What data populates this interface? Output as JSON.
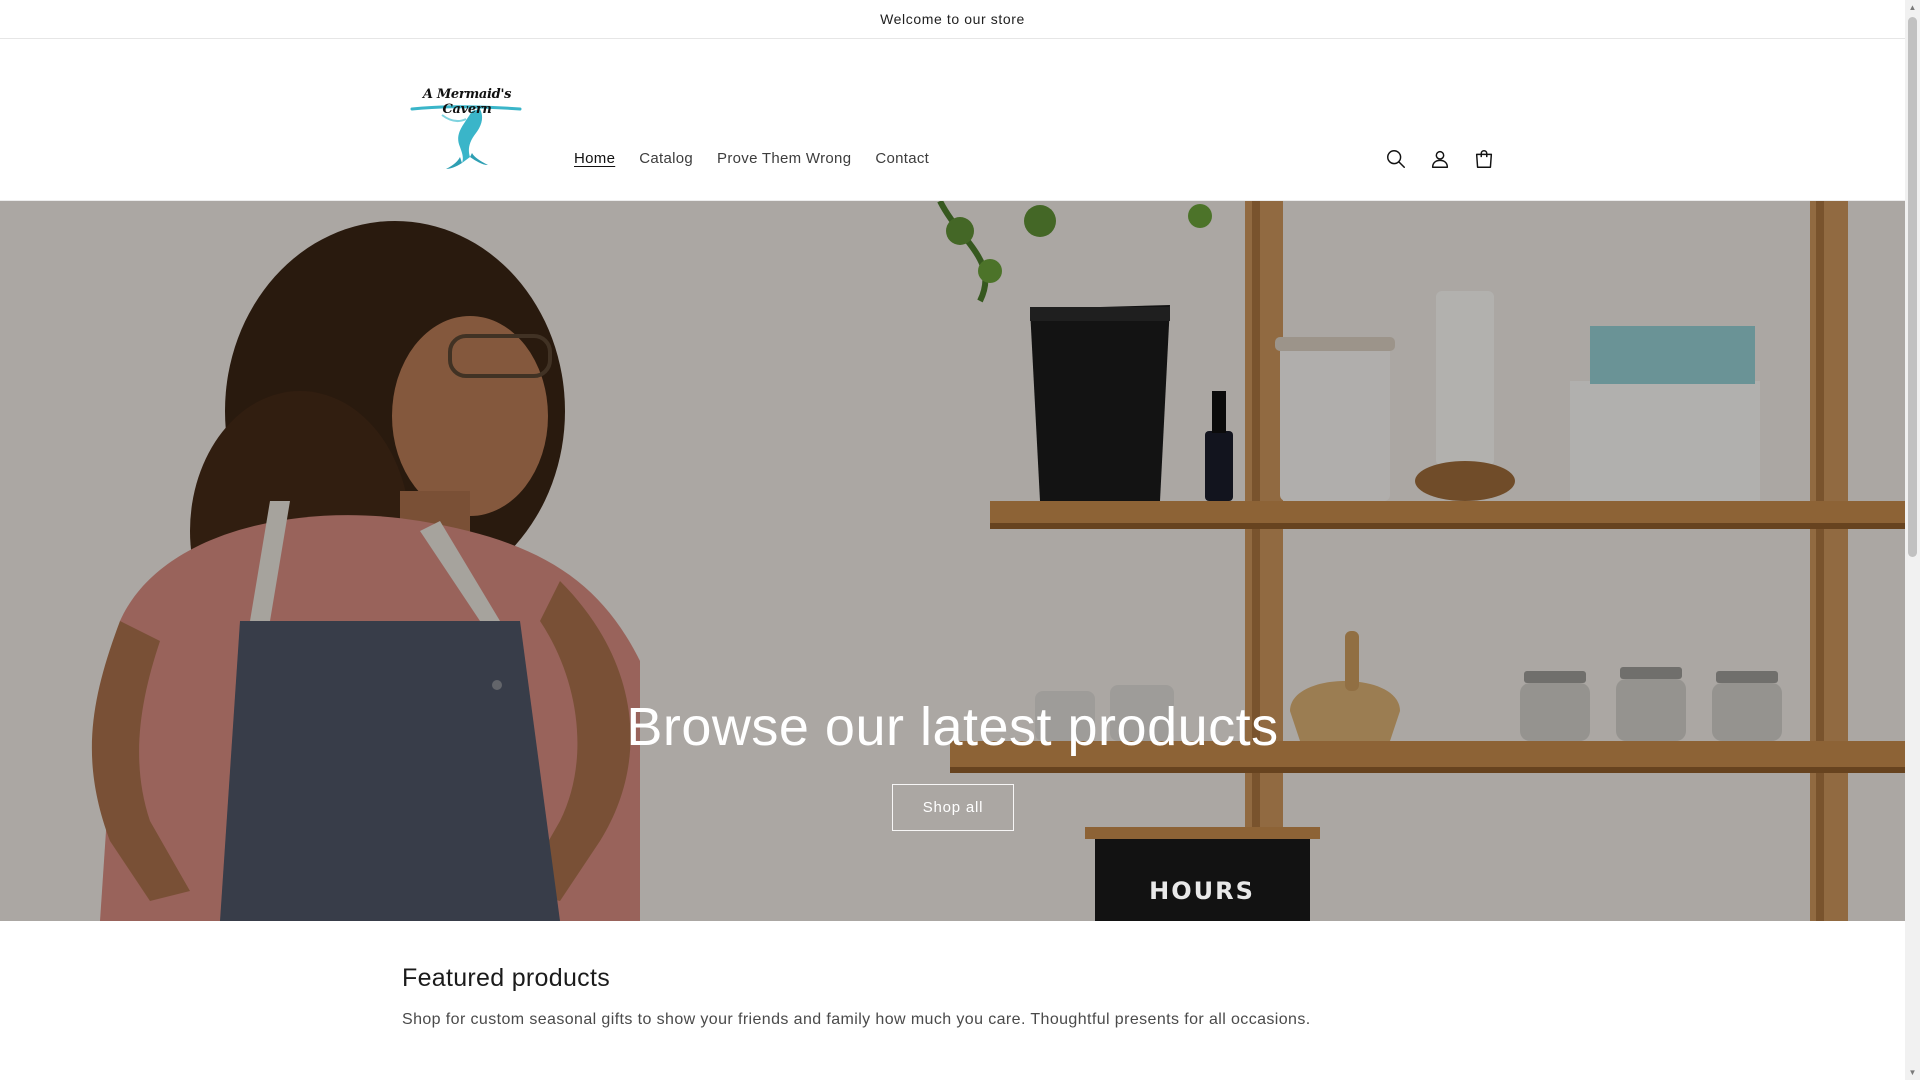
{
  "announcement": {
    "text": "Welcome to our store"
  },
  "header": {
    "logo_text": "A Mermaid's Cavern",
    "nav": [
      {
        "label": "Home",
        "active": true
      },
      {
        "label": "Catalog",
        "active": false
      },
      {
        "label": "Prove Them Wrong",
        "active": false
      },
      {
        "label": "Contact",
        "active": false
      }
    ],
    "icons": [
      "search-icon",
      "account-icon",
      "cart-icon"
    ]
  },
  "hero": {
    "title": "Browse our latest products",
    "button_label": "Shop all",
    "sign_text": "HOURS"
  },
  "featured": {
    "title": "Featured products",
    "description": "Shop for custom seasonal gifts to show your friends and family how much you care. Thoughtful presents for all occasions."
  },
  "colors": {
    "text": "#121212",
    "logo_teal": "#3ab5c9",
    "hero_overlay": "#000000"
  }
}
